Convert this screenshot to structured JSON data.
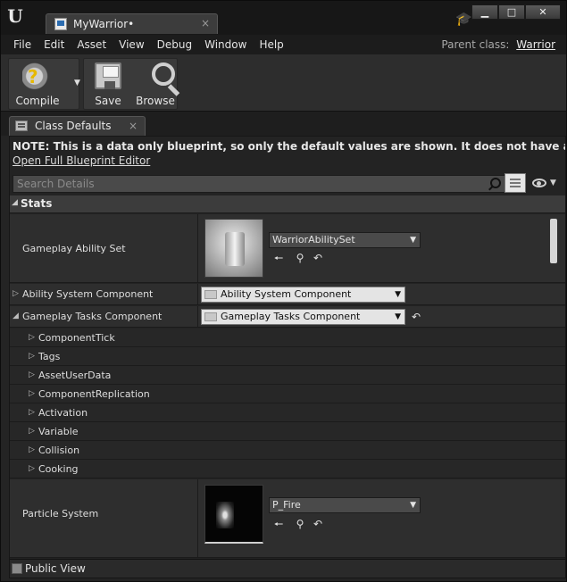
{
  "window": {
    "tab_title": "MyWarrior•",
    "close_glyph": "×",
    "controls": [
      "▁",
      "□",
      "✕"
    ]
  },
  "menubar": {
    "items": [
      "File",
      "Edit",
      "Asset",
      "View",
      "Debug",
      "Window",
      "Help"
    ],
    "parent_class_label": "Parent class:",
    "parent_class_value": "Warrior"
  },
  "toolbar": {
    "compile_label": "Compile",
    "save_label": "Save",
    "browse_label": "Browse"
  },
  "panel": {
    "tab_label": "Class Defaults",
    "close_glyph": "×",
    "note": "NOTE: This is a data only blueprint, so only the default values are shown.  It does not have any script or variables.  If you wa",
    "open_editor_link": "Open Full Blueprint Editor",
    "search_placeholder": "Search Details",
    "category": "Stats",
    "public_view_label": "Public View"
  },
  "properties": {
    "gameplay_ability_set": {
      "label": "Gameplay Ability Set",
      "value": "WarriorAbilitySet"
    },
    "ability_system_component": {
      "label": "Ability System Component",
      "value": "Ability System Component"
    },
    "gameplay_tasks_component": {
      "label": "Gameplay Tasks Component",
      "value": "Gameplay Tasks Component"
    },
    "sub_items": [
      "ComponentTick",
      "Tags",
      "AssetUserData",
      "ComponentReplication",
      "Activation",
      "Variable",
      "Collision",
      "Cooking"
    ],
    "particle_system": {
      "label": "Particle System",
      "value": "P_Fire"
    }
  },
  "icons": {
    "use_selected": "🠔",
    "browse": "⚲",
    "reset": "↶",
    "expand_right": "▷",
    "expand_down": "◢",
    "combo_arrow": "▼"
  }
}
